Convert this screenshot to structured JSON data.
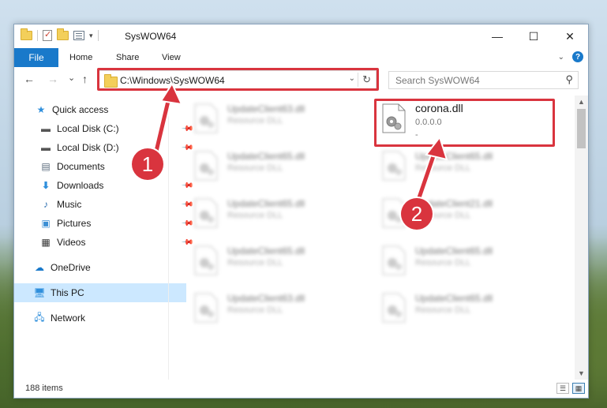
{
  "window": {
    "title": "SysWOW64",
    "controls": {
      "minimize": "—",
      "maximize": "☐",
      "close": "✕"
    }
  },
  "ribbon": {
    "tabs": [
      "File",
      "Home",
      "Share",
      "View"
    ]
  },
  "navigation": {
    "back": "←",
    "forward": "→",
    "recent": "⌄",
    "up": "↑",
    "address": "C:\\Windows\\SysWOW64",
    "refresh": "↻",
    "search_placeholder": "Search SysWOW64"
  },
  "sidebar": {
    "items": [
      {
        "label": "Quick access",
        "icon": "star-icon"
      },
      {
        "label": "Local Disk (C:)",
        "icon": "drive-icon"
      },
      {
        "label": "Local Disk (D:)",
        "icon": "drive-icon"
      },
      {
        "label": "Documents",
        "icon": "documents-icon"
      },
      {
        "label": "Downloads",
        "icon": "downloads-icon"
      },
      {
        "label": "Music",
        "icon": "music-icon"
      },
      {
        "label": "Pictures",
        "icon": "pictures-icon"
      },
      {
        "label": "Videos",
        "icon": "videos-icon"
      },
      {
        "label": "OneDrive",
        "icon": "cloud-icon"
      },
      {
        "label": "This PC",
        "icon": "computer-icon"
      },
      {
        "label": "Network",
        "icon": "network-icon"
      }
    ]
  },
  "files": {
    "left": [
      {
        "name": "UpdateClient63.dll",
        "type": "Resource DLL"
      },
      {
        "name": "UpdateClient65.dll",
        "type": "Resource DLL"
      },
      {
        "name": "UpdateClient65.dll",
        "type": "Resource DLL"
      },
      {
        "name": "UpdateClient65.dll",
        "type": "Resource DLL"
      },
      {
        "name": "UpdateClient63.dll",
        "type": "Resource DLL"
      }
    ],
    "right": [
      {
        "name": "corona.dll",
        "type": "0.0.0.0",
        "extra": "-"
      },
      {
        "name": "UpdateClient65.dll",
        "type": "Resource DLL"
      },
      {
        "name": "UpdateClient21.dll",
        "type": "Resource DLL"
      },
      {
        "name": "UpdateClient65.dll",
        "type": "Resource DLL"
      },
      {
        "name": "UpdateClient65.dll",
        "type": "Resource DLL"
      }
    ]
  },
  "status": {
    "item_count": "188 items"
  },
  "callouts": [
    "1",
    "2"
  ],
  "colors": {
    "accent": "#1979ca",
    "highlight": "#d9343e",
    "selected": "#cce8ff"
  }
}
